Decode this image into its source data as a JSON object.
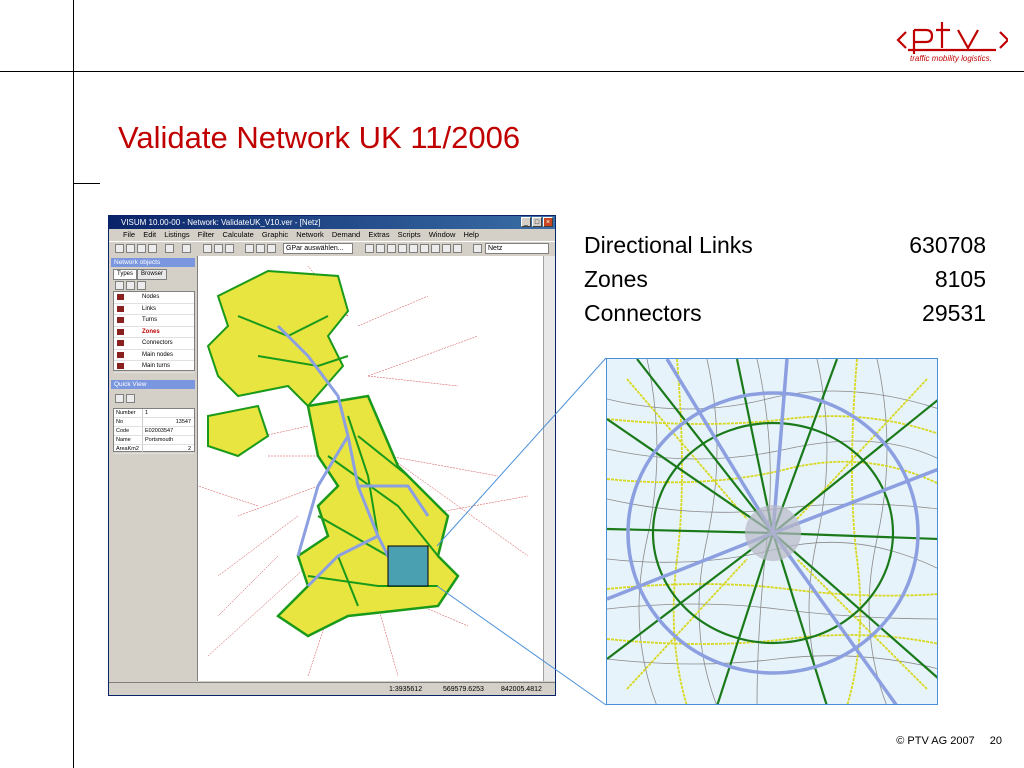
{
  "slide": {
    "title": "Validate Network UK 11/2006",
    "logo_text": "ptv",
    "logo_tagline": "traffic mobility logistics.",
    "copyright": "© PTV AG 2007",
    "page_number": "20"
  },
  "stats": [
    {
      "label": "Directional Links",
      "value": "630708"
    },
    {
      "label": "Zones",
      "value": "8105"
    },
    {
      "label": "Connectors",
      "value": "29531"
    }
  ],
  "app": {
    "window_title": "VISUM 10.00-00 - Network: ValidateUK_V10.ver - [Netz]",
    "menu": [
      "File",
      "Edit",
      "Listings",
      "Filter",
      "Calculate",
      "Graphic",
      "Network",
      "Demand",
      "Extras",
      "Scripts",
      "Window",
      "Help"
    ],
    "graphic_params_placeholder": "GPar auswählen...",
    "view_name": "Netz",
    "network_objects_header": "Network objects",
    "tabs": [
      "Types",
      "Browser"
    ],
    "object_types": [
      "Nodes",
      "Links",
      "Turns",
      "Zones",
      "Connectors",
      "Main nodes",
      "Main turns"
    ],
    "selected_object_type": "Zones",
    "quick_view_header": "Quick View",
    "quick_view": [
      {
        "key": "Number",
        "value": "1"
      },
      {
        "key": "No",
        "value": "13547"
      },
      {
        "key": "Code",
        "value": "E02003547"
      },
      {
        "key": "Name",
        "value": "Portsmouth"
      },
      {
        "key": "AreaKm2",
        "value": "2"
      }
    ],
    "status": {
      "scale": "1:3935612",
      "x": "569579.6253",
      "y": "842005.4812"
    }
  },
  "colors": {
    "title_red": "#c00000",
    "motorway_blue": "#8c9fe0",
    "primary_green": "#1a9a1a",
    "secondary_yellow": "#d8d820",
    "minor_grey": "#8a8a8a",
    "connector_red": "#d04040"
  }
}
